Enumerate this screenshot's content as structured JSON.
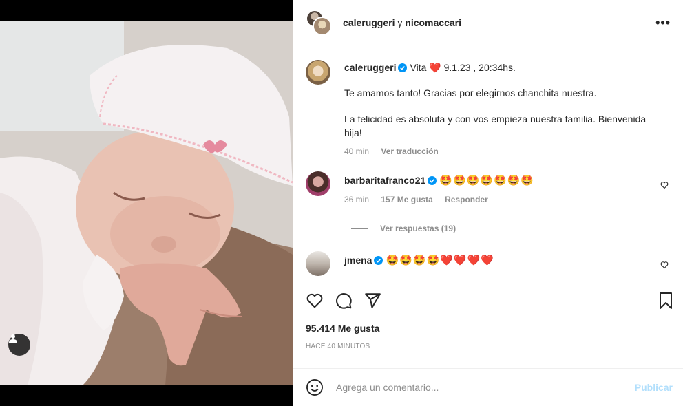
{
  "colors": {
    "accent": "#0095f6",
    "post_disabled": "#b2dffc",
    "muted": "#8e8e8e",
    "heart_red": "#ed4956"
  },
  "media": {
    "tag_icon": "user-tag-icon"
  },
  "header": {
    "user1": "caleruggeri",
    "separator": "y",
    "user2": "nicomaccari",
    "more_icon": "more-options-icon"
  },
  "caption": {
    "username": "caleruggeri",
    "first_line_text": "Vita",
    "first_line_emoji": "❤️",
    "first_line_date": "9.1.23 , 20:34hs.",
    "paragraph1": "Te amamos tanto! Gracias por elegirnos chanchita nuestra.",
    "paragraph2": "La felicidad es absoluta y con vos empieza nuestra familia. Bienvenida hija!",
    "time": "40 min",
    "translate": "Ver traducción"
  },
  "comments": [
    {
      "username": "barbaritafranco21",
      "text": "🤩🤩🤩🤩🤩🤩🤩",
      "time": "36 min",
      "likes": "157 Me gusta",
      "reply": "Responder",
      "view_replies": "Ver respuestas (19)"
    },
    {
      "username": "jmena",
      "text": "🤩🤩🤩🤩❤️❤️❤️❤️"
    }
  ],
  "actions": {
    "like_icon": "heart-icon",
    "comment_icon": "comment-icon",
    "share_icon": "share-icon",
    "save_icon": "bookmark-icon",
    "likes": "95.414 Me gusta",
    "time_ago": "HACE 40 MINUTOS"
  },
  "composer": {
    "emoji_icon": "emoji-icon",
    "placeholder": "Agrega un comentario...",
    "post_label": "Publicar"
  }
}
